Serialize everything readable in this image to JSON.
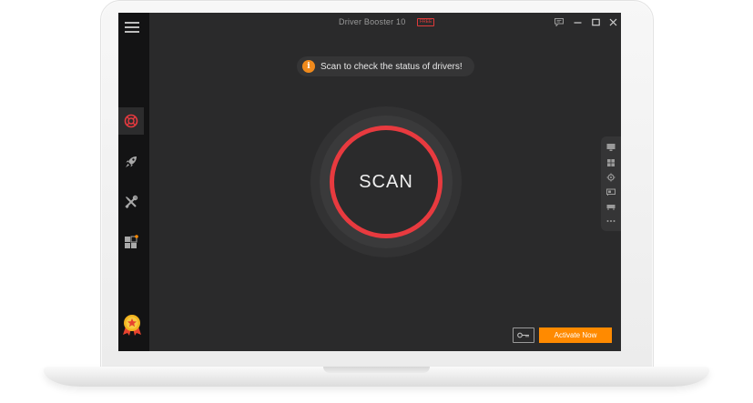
{
  "window": {
    "title": "Driver Booster 10",
    "edition_badge": "FREE"
  },
  "notice": {
    "icon": "info-icon",
    "info_glyph": "i",
    "text": "Scan to check the status of drivers!"
  },
  "scan": {
    "label": "SCAN"
  },
  "sidebar": {
    "items": [
      {
        "icon": "lifebuoy-icon",
        "active": true
      },
      {
        "icon": "rocket-icon",
        "active": false
      },
      {
        "icon": "tools-icon",
        "active": false
      },
      {
        "icon": "apps-grid-icon",
        "active": false
      }
    ],
    "bottom_icon": "award-icon"
  },
  "right_rail": {
    "items": [
      "monitor-icon",
      "windows-icon",
      "chip-icon",
      "gpu-icon",
      "network-card-icon",
      "more-icon"
    ]
  },
  "footer": {
    "key_icon": "key-icon",
    "activate_label": "Activate Now"
  },
  "colors": {
    "accent_red": "#e83a3f",
    "accent_orange": "#ff8a00",
    "background": "#2a2a2b",
    "sidebar": "#131314"
  }
}
